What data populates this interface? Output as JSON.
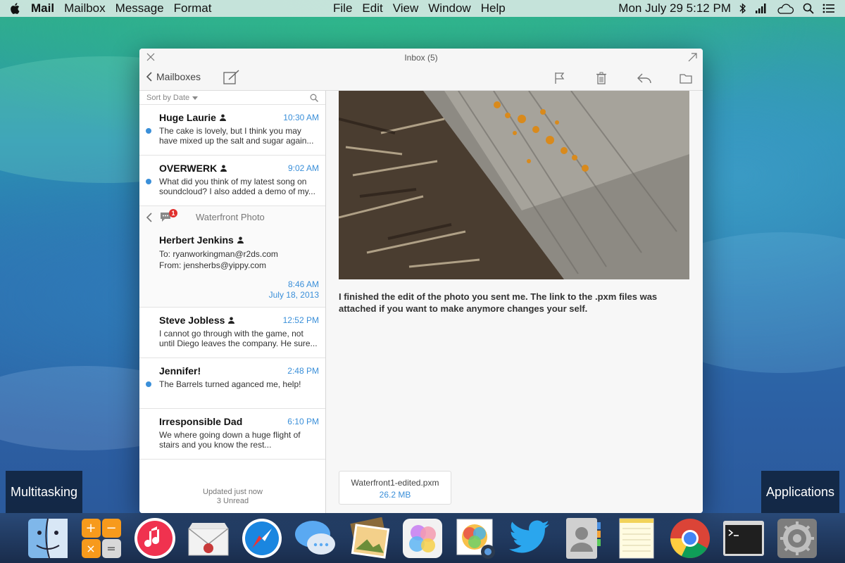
{
  "menubar": {
    "app_name": "Mail",
    "left_menus": [
      "Mailbox",
      "Message",
      "Format"
    ],
    "center_menus": [
      "File",
      "Edit",
      "View",
      "Window",
      "Help"
    ],
    "clock": "Mon July 29 5:12 PM"
  },
  "window": {
    "title": "Inbox (5)",
    "back_label": "Mailboxes"
  },
  "list": {
    "sort_label": "Sort by Date",
    "messages_top": [
      {
        "sender": "Huge Laurie",
        "time": "10:30 AM",
        "preview": "The cake is lovely, but I think you may have mixed up the salt and sugar again...",
        "unread": true
      },
      {
        "sender": "OVERWERK",
        "time": "9:02 AM",
        "preview": "What did you think of my latest song on soundcloud? I also added a demo of my...",
        "unread": true
      }
    ],
    "thread": {
      "badge": "1",
      "title": "Waterfront Photo",
      "sender": "Herbert Jenkins",
      "to": "To: ryanworkingman@r2ds.com",
      "from": "From: jensherbs@yippy.com",
      "time": "8:46 AM",
      "date": "July 18, 2013"
    },
    "messages_bottom": [
      {
        "sender": "Steve Jobless",
        "time": "12:52 PM",
        "preview": "I cannot go through with the game, not until Diego leaves the company. He sure...",
        "unread": false
      },
      {
        "sender": "Jennifer!",
        "time": "2:48 PM",
        "preview": "The Barrels turned aganced me, help!",
        "unread": true
      },
      {
        "sender": "Irresponsible Dad",
        "time": "6:10 PM",
        "preview": "We where going down a huge flight of stairs and you know the rest...",
        "unread": false
      }
    ],
    "footer_status": "Updated just now",
    "footer_unread": "3 Unread"
  },
  "reading": {
    "body": "I finished the edit of the photo you sent me. The link to the .pxm files was attached if you want to make anymore changes your self.",
    "attachment_name": "Waterfront1-edited.pxm",
    "attachment_size": "26.2 MB"
  },
  "corners": {
    "left": "Multitasking",
    "right": "Applications"
  },
  "dock": [
    "finder-icon",
    "calculator-icon",
    "itunes-icon",
    "mail-icon",
    "safari-icon",
    "messages-icon",
    "image-viewer-icon",
    "game-center-icon",
    "photos-icon",
    "twitter-icon",
    "contacts-icon",
    "notes-icon",
    "chrome-icon",
    "terminal-icon",
    "system-preferences-icon"
  ],
  "colors": {
    "accent": "#3a8fd9",
    "badge": "#e0302d"
  }
}
